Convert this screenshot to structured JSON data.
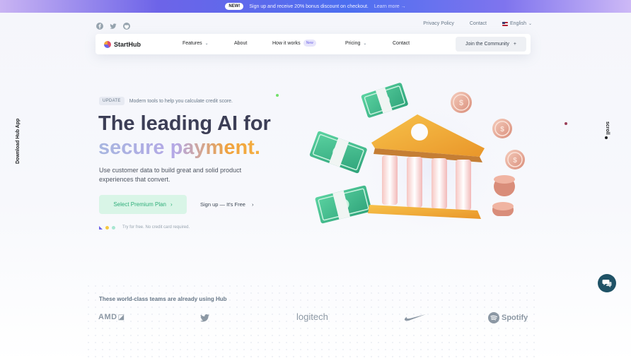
{
  "promo": {
    "badge": "NEW!",
    "text": "Sign up and receive 20% bonus discount on checkout.",
    "link": "Learn more →"
  },
  "utility_nav": {
    "privacy": "Privacy Policy",
    "contact": "Contact",
    "language": "English"
  },
  "navbar": {
    "brand": "StartHub",
    "features": "Features",
    "about": "About",
    "how_it_works": "How it works",
    "new_badge": "New",
    "pricing": "Pricing",
    "contact": "Contact",
    "community": "Join the Community",
    "community_icon": "+"
  },
  "side": {
    "download": "Download Hub App",
    "scroll": "scroll"
  },
  "hero": {
    "tag_badge": "UPDATE",
    "tag_text": "Modern tools to help you calculate credit score.",
    "title_line1": "The leading AI for",
    "title_line2": "secure payment.",
    "description": "Use customer data to build great and solid product experiences that convert.",
    "cta_primary": "Select Premium Plan",
    "cta_primary_icon": "›",
    "cta_secondary": "Sign up — It's Free",
    "cta_secondary_icon": "›",
    "trial_note": "Try for free. No credit card required."
  },
  "clients": {
    "title": "These world-class teams are already using Hub",
    "logos": [
      "AMD",
      "twitter",
      "logitech",
      "nike",
      "Spotify"
    ],
    "amd_text": "AMD",
    "logitech_text": "logitech",
    "spotify_text": "Spotify"
  },
  "colors": {
    "accent": "#6d64e8",
    "success": "#2fae7a",
    "title": "#3c3e56",
    "chat": "#1f5266"
  }
}
